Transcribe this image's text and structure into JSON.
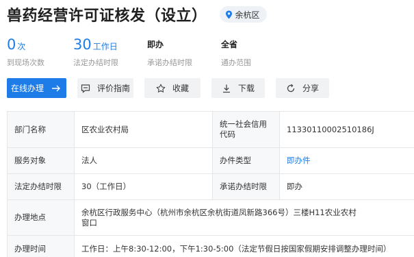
{
  "header": {
    "title": "兽药经营许可证核发（设立）",
    "region": "余杭区"
  },
  "stats": [
    {
      "value": "0",
      "unit": "次",
      "label": "到现场次数"
    },
    {
      "value": "30",
      "unit": "工作日",
      "label": "法定办结时限"
    },
    {
      "value": "即办",
      "unit": "",
      "label": "承诺办结时限"
    },
    {
      "value": "全省",
      "unit": "",
      "label": "通办范围"
    }
  ],
  "actions": {
    "online": "在线办理",
    "guide": "评价指南",
    "favorite": "收藏",
    "download": "下载",
    "share": "分享"
  },
  "table": {
    "dept_label": "部门名称",
    "dept_value": "区农业农村局",
    "credit_label": "统一社会信用代码",
    "credit_value": "11330110002510186J",
    "target_label": "服务对象",
    "target_value": "法人",
    "type_label": "办件类型",
    "type_value": "即办件",
    "legal_label": "法定办结时限",
    "legal_value": "30（工作日）",
    "promise_label": "承诺办结时限",
    "promise_value": "即办",
    "place_label": "办理地点",
    "place_value": "余杭区行政服务中心（杭州市余杭区余杭街道凤新路366号）三楼H11农业农村窗口",
    "time_label": "办理时间",
    "time_value": "工作日：上午8:30-12:00，下午1:30-5:00（法定节假日按国家假期安排调整办理时间）"
  },
  "colors": {
    "accent": "#1e7ce8",
    "label_bg": "#f7f8fa",
    "button_bg": "#f1f2f4"
  }
}
